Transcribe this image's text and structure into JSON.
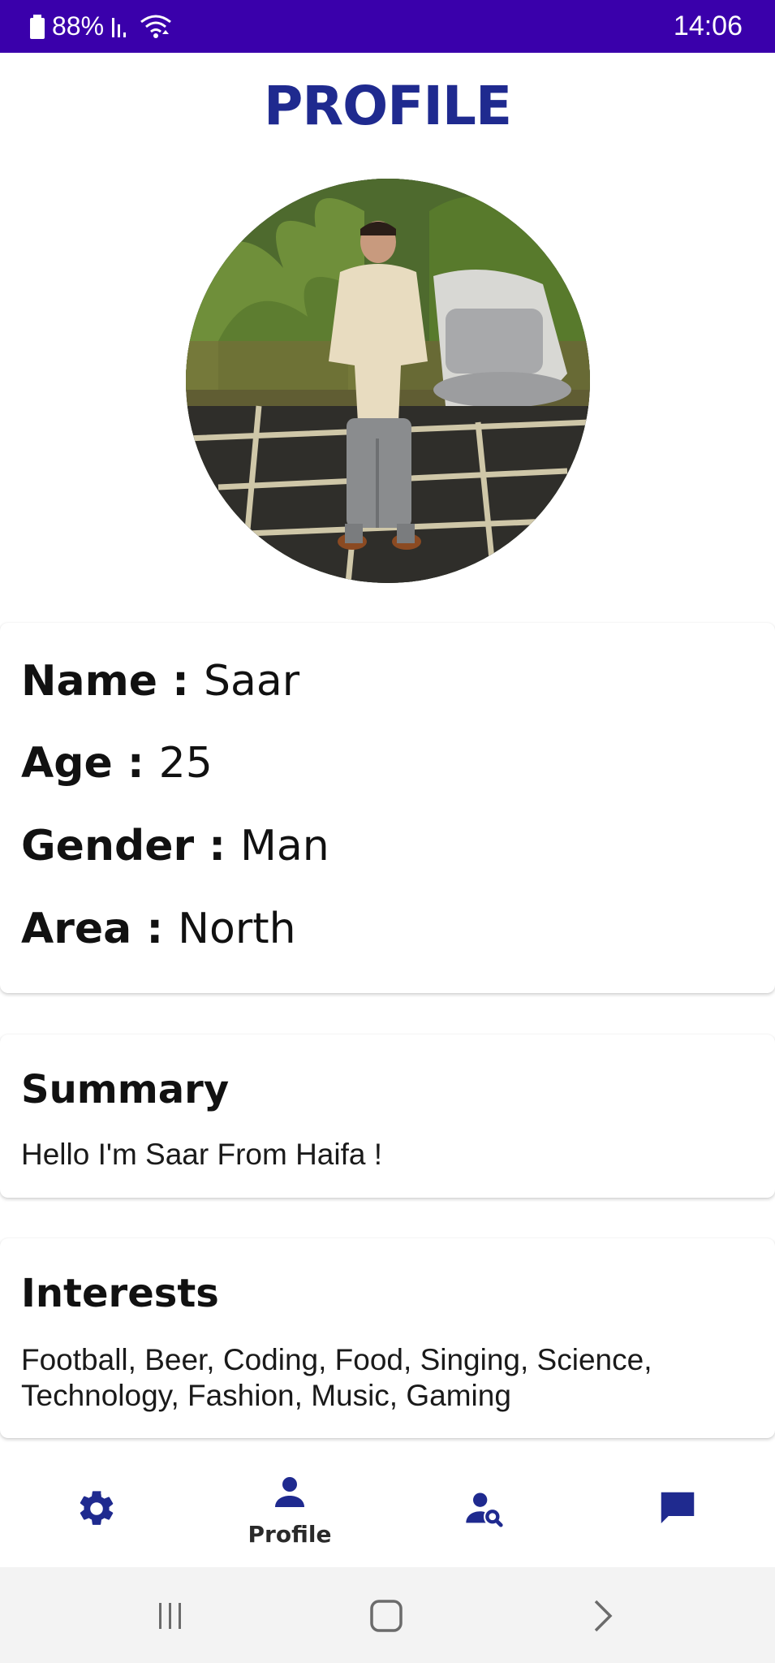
{
  "status_bar": {
    "battery": "88%",
    "time": "14:06",
    "background": "#3a00ab"
  },
  "page": {
    "title": "PROFILE",
    "accent_color": "#1f2a8f"
  },
  "profile": {
    "avatar_icon": "profile-photo",
    "fields": [
      {
        "label": "Name :",
        "value": "Saar"
      },
      {
        "label": "Age :",
        "value": "25"
      },
      {
        "label": "Gender :",
        "value": "Man"
      },
      {
        "label": "Area :",
        "value": "North"
      }
    ]
  },
  "summary": {
    "heading": "Summary",
    "text": "Hello I'm Saar From Haifa !"
  },
  "interests": {
    "heading": "Interests",
    "text": "Football, Beer, Coding, Food, Singing, Science, Technology, Fashion, Music, Gaming"
  },
  "bottom_nav": {
    "items": [
      {
        "icon": "gear-icon",
        "label": ""
      },
      {
        "icon": "person-icon",
        "label": "Profile"
      },
      {
        "icon": "person-search-icon",
        "label": ""
      },
      {
        "icon": "chat-icon",
        "label": ""
      }
    ]
  },
  "system_nav": {
    "icons": [
      "recent-apps-icon",
      "home-icon",
      "back-icon"
    ]
  }
}
